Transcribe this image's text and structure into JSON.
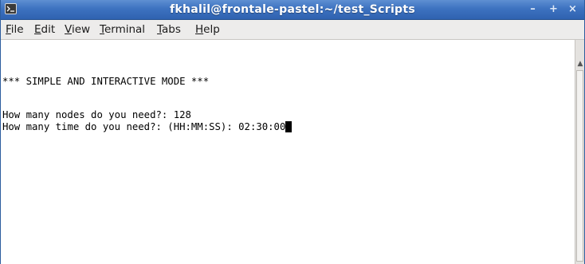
{
  "window": {
    "title": "fkhalil@frontale-pastel:~/test_Scripts",
    "icon": "terminal-icon",
    "controls": {
      "minimize_glyph": "–",
      "maximize_glyph": "+",
      "close_glyph": "×"
    }
  },
  "menubar": {
    "items": [
      {
        "label": "File",
        "underline": "F"
      },
      {
        "label": "Edit",
        "underline": "E"
      },
      {
        "label": "View",
        "underline": "V"
      },
      {
        "label": "Terminal",
        "underline": "T"
      },
      {
        "label": "Tabs",
        "underline": "T"
      },
      {
        "label": "Help",
        "underline": "H"
      }
    ]
  },
  "terminal": {
    "lines": [
      "",
      "*** SIMPLE AND INTERACTIVE MODE ***",
      "",
      "How many nodes do you need?: 128",
      "How many time do you need?: (HH:MM:SS): 02:30:00"
    ],
    "cursor_style": "block"
  },
  "colors": {
    "titlebar": "#3d72c0",
    "menubar_bg": "#edeceb",
    "terminal_bg": "#ffffff",
    "terminal_fg": "#000000"
  }
}
